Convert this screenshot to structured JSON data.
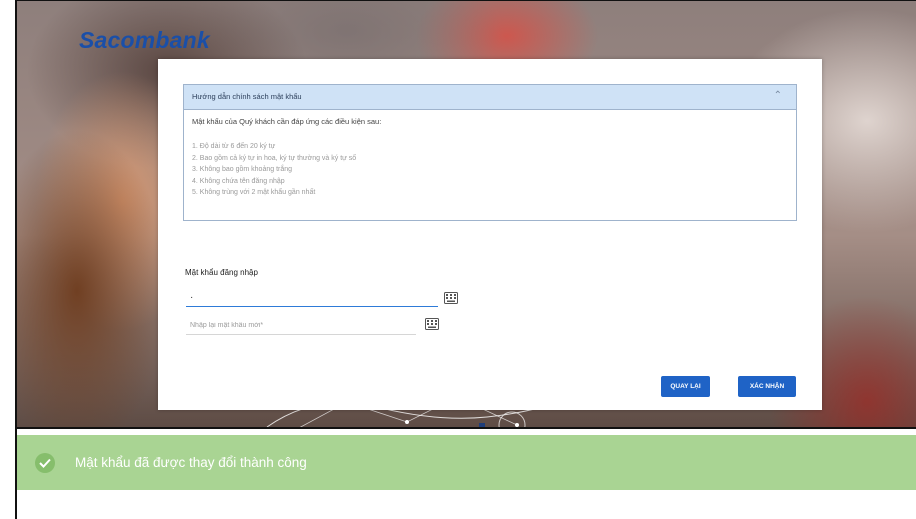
{
  "brand": {
    "logo_text": "Sacombank"
  },
  "policy": {
    "title": "Hướng dẫn chính sách mật khẩu",
    "intro": "Mật khẩu của Quý khách cần đáp ứng các điều kiện sau:",
    "rules": [
      "1. Độ dài từ 6 đến 20 ký tự",
      "2. Bao gồm cả ký tự in hoa, ký tự thường và ký tự số",
      "3. Không bao gồm khoảng trắng",
      "4. Không chứa tên đăng nhập",
      "5. Không trùng với 2 mật khẩu gần nhất"
    ],
    "toggle_icon": "chevron-up-icon"
  },
  "form": {
    "label": "Mật khẩu đăng nhập",
    "password_value": "·",
    "confirm_placeholder": "Nhập lại mật khẩu mới*",
    "keyboard_icon": "virtual-keyboard-icon"
  },
  "buttons": {
    "back": "QUAY LẠI",
    "confirm": "XÁC NHẬN"
  },
  "toast": {
    "message": "Mật khẩu đã được thay đổi thành công",
    "icon": "check-circle-icon"
  },
  "colors": {
    "primary": "#1f63c6",
    "success_bg": "#a9d493",
    "policy_header": "#cfe2f6",
    "logo": "#1a4fa8"
  }
}
